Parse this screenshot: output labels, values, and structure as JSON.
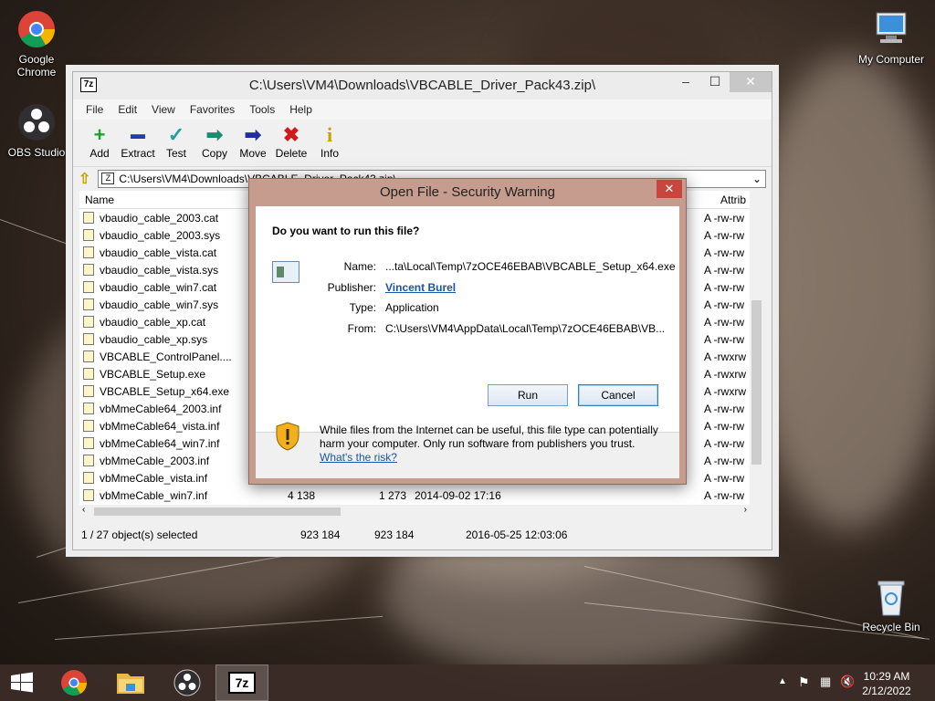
{
  "desktop": {
    "icons": [
      {
        "label": "Google Chrome"
      },
      {
        "label": "OBS Studio"
      },
      {
        "label": "My Computer"
      },
      {
        "label": "Recycle Bin"
      }
    ]
  },
  "window7z": {
    "title": "C:\\Users\\VM4\\Downloads\\VBCABLE_Driver_Pack43.zip\\",
    "app_icon": "7z",
    "menu": [
      "File",
      "Edit",
      "View",
      "Favorites",
      "Tools",
      "Help"
    ],
    "toolbar": [
      {
        "label": "Add",
        "icon": "plus-icon",
        "glyph": "+",
        "color": "#1fa32a"
      },
      {
        "label": "Extract",
        "icon": "minus-icon",
        "glyph": "▬",
        "color": "#1f3fae"
      },
      {
        "label": "Test",
        "icon": "check-icon",
        "glyph": "✓",
        "color": "#22a0a8"
      },
      {
        "label": "Copy",
        "icon": "copy-arrow-icon",
        "glyph": "➡",
        "color": "#1a8c70"
      },
      {
        "label": "Move",
        "icon": "move-arrow-icon",
        "glyph": "➡",
        "color": "#1f2e9e"
      },
      {
        "label": "Delete",
        "icon": "delete-x-icon",
        "glyph": "✖",
        "color": "#d11b1b"
      },
      {
        "label": "Info",
        "icon": "info-icon",
        "glyph": "i",
        "color": "#c8a200"
      }
    ],
    "address": "C:\\Users\\VM4\\Downloads\\VBCABLE_Driver_Pack43.zip\\",
    "columns": {
      "name": "Name",
      "attrib": "Attrib"
    },
    "files": [
      {
        "name": "vbaudio_cable_2003.cat",
        "attr": "A -rw-rw"
      },
      {
        "name": "vbaudio_cable_2003.sys",
        "attr": "A -rw-rw"
      },
      {
        "name": "vbaudio_cable_vista.cat",
        "attr": "A -rw-rw"
      },
      {
        "name": "vbaudio_cable_vista.sys",
        "attr": "A -rw-rw"
      },
      {
        "name": "vbaudio_cable_win7.cat",
        "attr": "A -rw-rw"
      },
      {
        "name": "vbaudio_cable_win7.sys",
        "attr": "A -rw-rw"
      },
      {
        "name": "vbaudio_cable_xp.cat",
        "attr": "A -rw-rw"
      },
      {
        "name": "vbaudio_cable_xp.sys",
        "attr": "A -rw-rw"
      },
      {
        "name": "VBCABLE_ControlPanel....",
        "attr": "A -rwxrw"
      },
      {
        "name": "VBCABLE_Setup.exe",
        "attr": "A -rwxrw"
      },
      {
        "name": "VBCABLE_Setup_x64.exe",
        "attr": "A -rwxrw"
      },
      {
        "name": "vbMmeCable64_2003.inf",
        "attr": "A -rw-rw"
      },
      {
        "name": "vbMmeCable64_vista.inf",
        "attr": "A -rw-rw"
      },
      {
        "name": "vbMmeCable64_win7.inf",
        "attr": "A -rw-rw"
      },
      {
        "name": "vbMmeCable_2003.inf",
        "attr": "A -rw-rw"
      },
      {
        "name": "vbMmeCable_vista.inf",
        "attr": "A -rw-rw"
      },
      {
        "name": "vbMmeCable_win7.inf",
        "attr": "A -rw-rw",
        "size": "4 138",
        "packed": "1 273",
        "modified": "2014-09-02 17:16"
      }
    ],
    "status": {
      "selected": "1 / 27 object(s) selected",
      "size": "923 184",
      "packed": "923 184",
      "modified": "2016-05-25 12:03:06"
    }
  },
  "dialog": {
    "title": "Open File - Security Warning",
    "question": "Do you want to run this file?",
    "fields": {
      "name_label": "Name:",
      "name_value": "...ta\\Local\\Temp\\7zOCE46EBAB\\VBCABLE_Setup_x64.exe",
      "publisher_label": "Publisher:",
      "publisher_value": "Vincent Burel",
      "type_label": "Type:",
      "type_value": "Application",
      "from_label": "From:",
      "from_value": "C:\\Users\\VM4\\AppData\\Local\\Temp\\7zOCE46EBAB\\VB..."
    },
    "run_label": "Run",
    "cancel_label": "Cancel",
    "warning": "While files from the Internet can be useful, this file type can potentially harm your computer. Only run software from publishers you trust.",
    "risk_link": "What's the risk?"
  },
  "taskbar": {
    "time": "10:29 AM",
    "date": "2/12/2022"
  }
}
